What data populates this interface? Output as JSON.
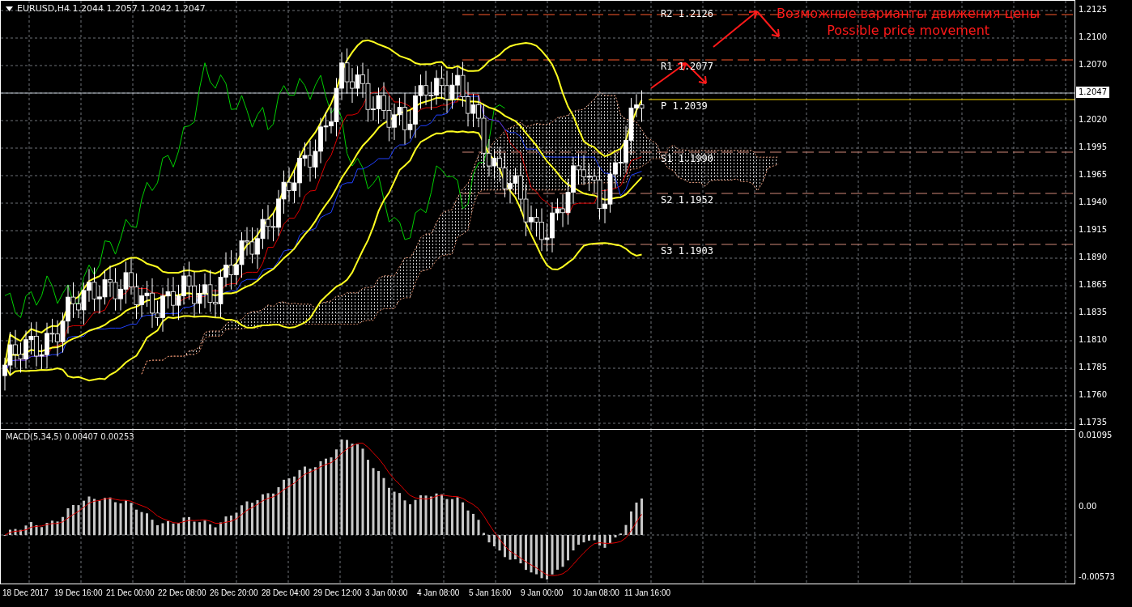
{
  "chart": {
    "title": "EURUSD,H4  1.2044 1.2057 1.2042 1.2047",
    "pivots": [
      {
        "label": "R2 1.2126",
        "kind": "resistance"
      },
      {
        "label": "R1 1.2077",
        "kind": "resistance"
      },
      {
        "label": "P 1.2039",
        "kind": "pivot"
      },
      {
        "label": "S1 1.1990",
        "kind": "support"
      },
      {
        "label": "S2 1.1952",
        "kind": "support"
      },
      {
        "label": "S3 1.1903",
        "kind": "support"
      }
    ],
    "annotation": [
      "Возможные варианты движения цены",
      "Possible price movement"
    ],
    "price_axis": [
      "1.2125",
      "1.2100",
      "1.2070",
      "1.2020",
      "1.1995",
      "1.1965",
      "1.1940",
      "1.1915",
      "1.1890",
      "1.1865",
      "1.1835",
      "1.1810",
      "1.1785",
      "1.1760",
      "1.1735"
    ],
    "current_price": "1.2047"
  },
  "macd": {
    "title": "MACD(5,34,5) 0.00407 0.00253",
    "axis": [
      "0.01095",
      "0.00",
      "-0.00573"
    ]
  },
  "time_axis": [
    "18 Dec 2017",
    "19 Dec 16:00",
    "21 Dec 00:00",
    "22 Dec 08:00",
    "26 Dec 20:00",
    "28 Dec 04:00",
    "29 Dec 12:00",
    "3 Jan 00:00",
    "4 Jan 08:00",
    "5 Jan 16:00",
    "9 Jan 00:00",
    "10 Jan 08:00",
    "11 Jan 16:00"
  ]
}
